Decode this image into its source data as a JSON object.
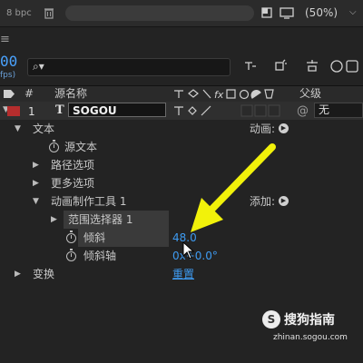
{
  "topbar": {
    "bit_depth": "8 bpc",
    "zoom": "(50%)"
  },
  "timeline": {
    "panel_menu": "≡",
    "timecode": "00",
    "fps": "fps)",
    "columns": {
      "number": "#",
      "source_name": "源名称",
      "parent": "父级"
    },
    "layer": {
      "number": "1",
      "type_glyph": "T",
      "name": "SOGOU",
      "parent_value": "无"
    },
    "rows": {
      "text": "文本",
      "source_text": "源文本",
      "path_options": "路径选项",
      "more_options": "更多选项",
      "animator": "动画制作工具 1",
      "range_selector": "范围选择器 1",
      "skew": "倾斜",
      "skew_axis": "倾斜轴",
      "transform": "变换"
    },
    "values": {
      "animate_label": "动画:",
      "add_label": "添加:",
      "skew_value": "48.0",
      "skew_axis_value": "0x+0.0°",
      "reset": "重置"
    },
    "colors": {
      "label_red": "#b52d2d",
      "value_blue": "#3e9bf2",
      "annotation_arrow": "#f2f20a"
    }
  },
  "watermark": {
    "brand": "搜狗指南",
    "url": "zhinan.sogou.com"
  }
}
